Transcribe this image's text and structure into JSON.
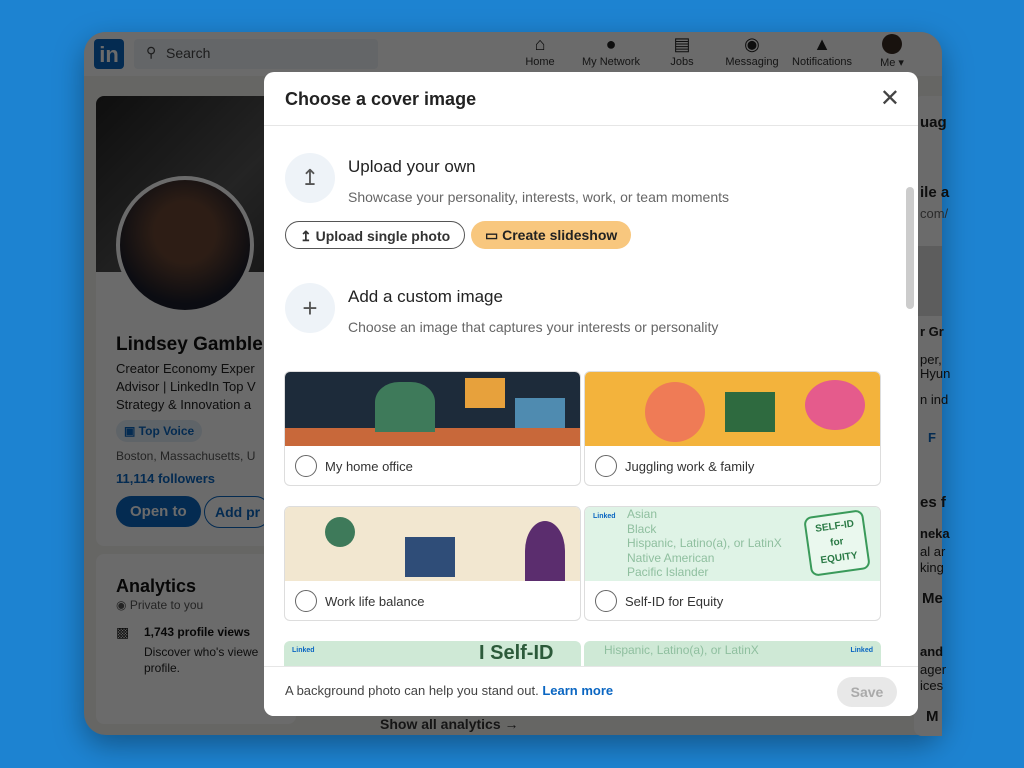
{
  "topbar": {
    "logo": "in",
    "search_placeholder": "Search",
    "nav": [
      {
        "label": "Home",
        "icon": "home-icon"
      },
      {
        "label": "My Network",
        "icon": "network-icon"
      },
      {
        "label": "Jobs",
        "icon": "briefcase-icon"
      },
      {
        "label": "Messaging",
        "icon": "message-icon"
      },
      {
        "label": "Notifications",
        "icon": "bell-icon"
      },
      {
        "label": "Me ▾",
        "icon": "avatar"
      }
    ]
  },
  "profile": {
    "name": "Lindsey Gamble",
    "headline": [
      "Creator Economy Exper",
      "Advisor | LinkedIn Top V",
      "Strategy & Innovation a"
    ],
    "badge": "Top Voice",
    "location": "Boston, Massachusetts, U",
    "followers": "11,114 followers",
    "open_to": "Open to",
    "add_profile": "Add pr"
  },
  "analytics": {
    "title": "Analytics",
    "privacy": "Private to you",
    "views": "1,743 profile views",
    "views_desc": [
      "Discover who's viewe",
      "profile."
    ],
    "show_all": "Show all analytics →"
  },
  "right_fragments": [
    "uag",
    "ile a",
    "com/",
    "r Gr",
    "per,",
    "Hyun",
    "n ind",
    "F",
    "es f",
    "neka",
    "al ar",
    "king",
    "Me",
    "and",
    "ager",
    "ices",
    "M"
  ],
  "modal": {
    "title": "Choose a cover image",
    "upload_title": "Upload your own",
    "upload_desc": "Showcase your personality, interests, work, or team moments",
    "upload_btn": "Upload single photo",
    "slideshow_btn": "Create slideshow",
    "custom_title": "Add a custom image",
    "custom_desc": "Choose an image that captures your interests or personality",
    "options": [
      {
        "label": "My home office",
        "selected": false
      },
      {
        "label": "Juggling work & family",
        "selected": false
      },
      {
        "label": "Work life balance",
        "selected": false
      },
      {
        "label": "Self-ID for Equity",
        "selected": false
      }
    ],
    "selfid": {
      "brand": "Linked",
      "stamp": [
        "SELF-ID",
        "for",
        "EQUITY"
      ],
      "checklist": [
        "Asian",
        "Black",
        "Hispanic, Latino(a), or LatinX",
        "Native American",
        "Pacific Islander"
      ],
      "row3_left": "I Self-ID",
      "row3_right": "Hispanic, Latino(a), or LatinX"
    },
    "footer_text": "A background photo can help you stand out.",
    "learn_more": "Learn more",
    "save": "Save"
  },
  "colors": {
    "background": "#1d83d1",
    "brand": "#0a66c2",
    "slideshow": "#f8c77e"
  }
}
